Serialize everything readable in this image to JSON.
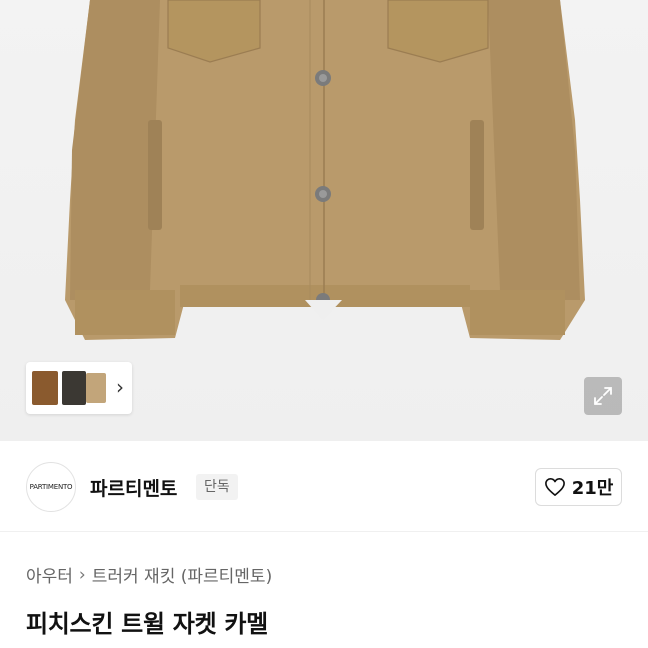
{
  "colors": {
    "jacket": "#b99a6b",
    "jacket_shadow": "#a3855a",
    "background": "#efefef",
    "text_primary": "#111111",
    "text_secondary": "#666666"
  },
  "gallery": {
    "thumbnails": [
      "brown-jacket",
      "black-jacket",
      "camel-jacket"
    ],
    "next_icon": "chevron-right-icon",
    "expand_icon": "expand-arrows-icon"
  },
  "brand": {
    "logo_text": "PARTIMENTO",
    "name": "파르티멘토",
    "badge": "단독"
  },
  "like": {
    "icon": "heart-outline-icon",
    "count": "21만"
  },
  "breadcrumb": {
    "category": "아우터",
    "subcategory": "트러커 재킷 (파르티멘토)"
  },
  "product": {
    "title": "피치스킨 트윌 자켓 카멜"
  }
}
